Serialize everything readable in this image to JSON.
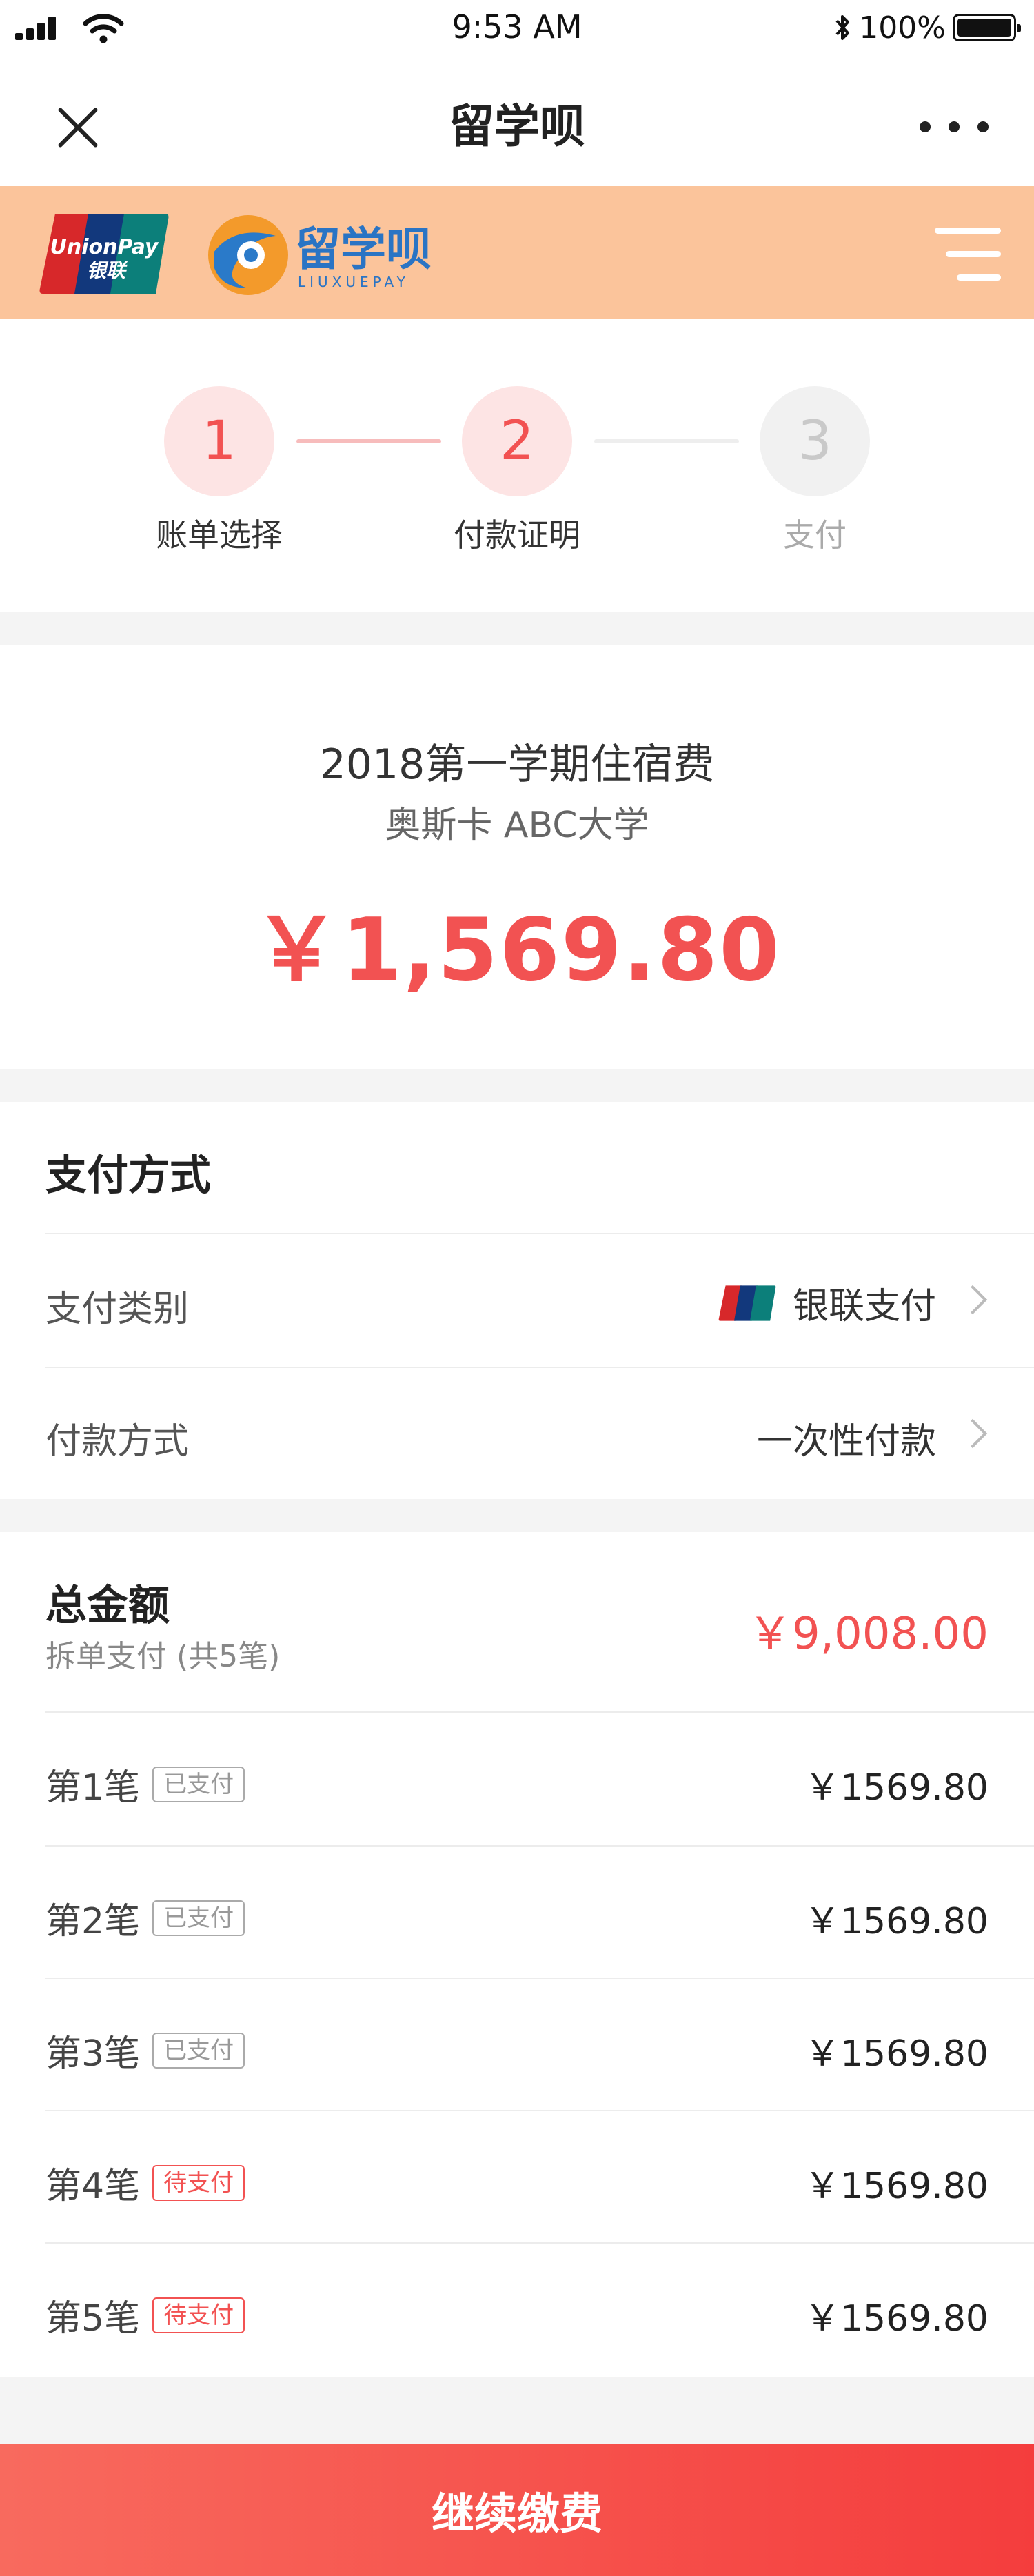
{
  "status_bar": {
    "time": "9:53 AM",
    "battery": "100%"
  },
  "nav": {
    "title": "留学呗"
  },
  "brand": {
    "unionpay_line1": "UnionPay",
    "unionpay_line2": "银联",
    "logo_text": "留学呗",
    "logo_sub": "LIUXUEPAY"
  },
  "steps": [
    {
      "number": "1",
      "label": "账单选择",
      "state": "done"
    },
    {
      "number": "2",
      "label": "付款证明",
      "state": "current"
    },
    {
      "number": "3",
      "label": "支付",
      "state": "todo"
    }
  ],
  "bill": {
    "title": "2018第一学期住宿费",
    "school": "奥斯卡 ABC大学",
    "amount": "￥1,569.80"
  },
  "payment": {
    "section_title": "支付方式",
    "type_label": "支付类别",
    "type_value": "银联支付",
    "method_label": "付款方式",
    "method_value": "一次性付款"
  },
  "total": {
    "title": "总金额",
    "subtitle": "拆单支付 (共5笔)",
    "amount": "￥9,008.00",
    "installments": [
      {
        "label": "第1笔",
        "status": "已支付",
        "amount": "￥1569.80",
        "paid": true
      },
      {
        "label": "第2笔",
        "status": "已支付",
        "amount": "￥1569.80",
        "paid": true
      },
      {
        "label": "第3笔",
        "status": "已支付",
        "amount": "￥1569.80",
        "paid": true
      },
      {
        "label": "第4笔",
        "status": "待支付",
        "amount": "￥1569.80",
        "paid": false
      },
      {
        "label": "第5笔",
        "status": "待支付",
        "amount": "￥1569.80",
        "paid": false
      }
    ]
  },
  "button": {
    "label": "继续缴费"
  },
  "colors": {
    "accent": "#f25252",
    "brand_bar": "#fbc49b",
    "step_bg": "#fde4e4"
  }
}
